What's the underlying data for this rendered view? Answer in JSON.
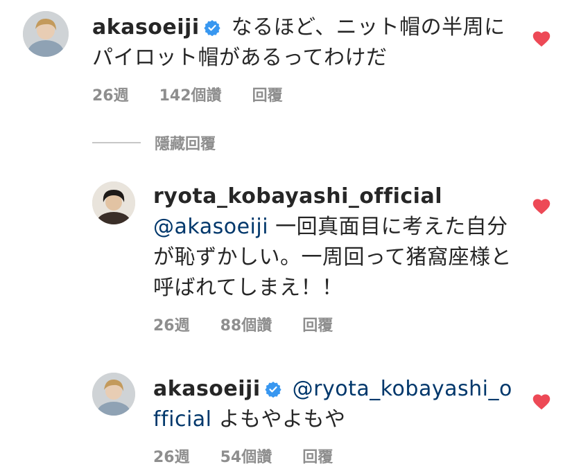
{
  "comments": [
    {
      "username": "akasoeiji",
      "verified": true,
      "mention": "",
      "text": "なるほど、ニット帽の半周にパイロット帽があるってわけだ",
      "time": "26週",
      "likes": "142個讚",
      "reply_label": "回覆",
      "liked": true
    },
    {
      "username": "ryota_kobayashi_official",
      "verified": false,
      "mention": "@akasoeiji",
      "text": "一回真面目に考えた自分が恥ずかしい。一周回って猪窩座様と呼ばれてしまえ！！",
      "time": "26週",
      "likes": "88個讚",
      "reply_label": "回覆",
      "liked": true
    },
    {
      "username": "akasoeiji",
      "verified": true,
      "mention": "@ryota_kobayashi_official",
      "text": "よもやよもや",
      "time": "26週",
      "likes": "54個讚",
      "reply_label": "回覆",
      "liked": true
    }
  ],
  "hide_replies_label": "隱藏回覆",
  "colors": {
    "heart": "#ed4956",
    "verified": "#3897f0",
    "mention": "#00376b",
    "meta": "#8e8e8e"
  },
  "icons": {
    "heart": "heart-icon",
    "verified": "verified-badge-icon"
  }
}
